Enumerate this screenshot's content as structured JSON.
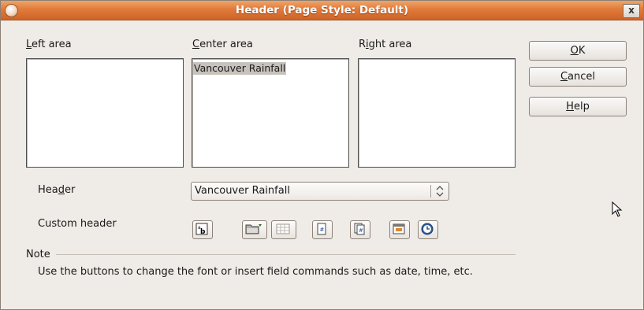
{
  "window": {
    "title": "Header (Page Style: Default)",
    "close_symbol": "x"
  },
  "areas": {
    "left_label": "Left area",
    "center_label": "Center area",
    "right_label": "Right area",
    "left_text": "",
    "center_text": "Vancouver Rainfall",
    "right_text": ""
  },
  "buttons": {
    "ok": "OK",
    "cancel": "Cancel",
    "help": "Help"
  },
  "header": {
    "label": "Header",
    "selected": "Vancouver Rainfall"
  },
  "custom_header": {
    "label": "Custom header",
    "tools": [
      "text-attributes-icon",
      "file-name-icon",
      "sheet-name-icon",
      "page-icon",
      "pages-icon",
      "date-icon",
      "time-icon"
    ]
  },
  "note": {
    "title": "Note",
    "text": "Use the buttons to change the font or insert field commands such as date, time, etc."
  },
  "colors": {
    "title_bar": "#e07a3a",
    "dialog_bg": "#efebe7"
  }
}
